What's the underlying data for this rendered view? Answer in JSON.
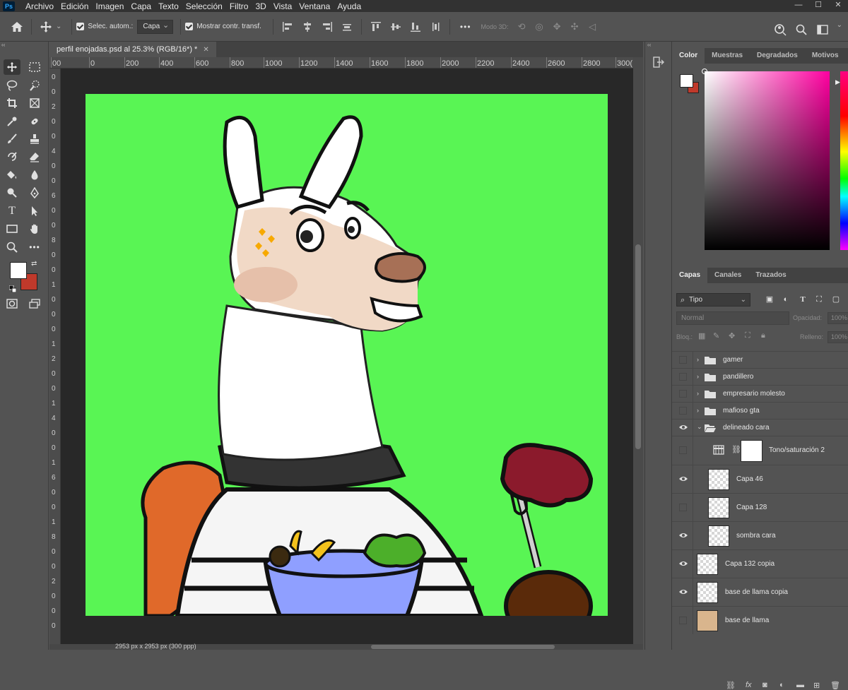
{
  "app": {
    "logo_text": "Ps",
    "menu": [
      "Archivo",
      "Edición",
      "Imagen",
      "Capa",
      "Texto",
      "Selección",
      "Filtro",
      "3D",
      "Vista",
      "Ventana",
      "Ayuda"
    ],
    "window_controls": [
      "—",
      "☐",
      "✕"
    ]
  },
  "options_bar": {
    "auto_select_label": "Selec. autom.:",
    "auto_select_target": "Capa",
    "show_transform_label": "Mostrar contr. transf.",
    "mode_3d_label": "Modo 3D:",
    "more_label": "•••"
  },
  "document": {
    "tab_title": "perfil enojadas.psd al 25.3% (RGB/16*) *",
    "close_glyph": "✕",
    "ruler_top_labels": [
      "00",
      "0",
      "200",
      "400",
      "600",
      "800",
      "1000",
      "1200",
      "1400",
      "1600",
      "1800",
      "2000",
      "2200",
      "2400",
      "2600",
      "2800",
      "300("
    ],
    "ruler_left_labels": [
      "0",
      "0",
      "2",
      "0",
      "0",
      "4",
      "0",
      "0",
      "6",
      "0",
      "0",
      "8",
      "0",
      "0",
      "1",
      "0",
      "0",
      "0",
      "1",
      "2",
      "0",
      "0",
      "1",
      "4",
      "0",
      "0",
      "1",
      "6",
      "0",
      "0",
      "1",
      "8",
      "0",
      "0",
      "2",
      "0",
      "0",
      "0"
    ],
    "canvas_color": "#59f554",
    "status_text": "2953 px x 2953 px (300 ppp)"
  },
  "colors": {
    "foreground": "#ffffff",
    "background": "#c0392b"
  },
  "color_panel": {
    "tabs": [
      "Color",
      "Muestras",
      "Degradados",
      "Motivos"
    ],
    "active_tab": "Color",
    "hue_color": "#ff00a0"
  },
  "layers_panel": {
    "tabs": [
      "Capas",
      "Canales",
      "Trazados"
    ],
    "active_tab": "Capas",
    "filter_kind": "Tipo",
    "blend_mode": "Normal",
    "opacity_label": "Opacidad:",
    "opacity_value": "100%",
    "lock_label": "Bloq.:",
    "fill_label": "Relleno:",
    "fill_value": "100%",
    "layers": [
      {
        "name": "gamer",
        "type": "group",
        "visible": false,
        "expanded": false
      },
      {
        "name": "pandillero",
        "type": "group",
        "visible": false,
        "expanded": false
      },
      {
        "name": "empresario molesto",
        "type": "group",
        "visible": false,
        "expanded": false
      },
      {
        "name": "mafioso gta",
        "type": "group",
        "visible": false,
        "expanded": false
      },
      {
        "name": "delineado cara",
        "type": "group",
        "visible": true,
        "expanded": true
      },
      {
        "name": "Tono/saturación 2",
        "type": "adjustment",
        "visible": false
      },
      {
        "name": "Capa 46",
        "type": "layer",
        "visible": true
      },
      {
        "name": "Capa 128",
        "type": "layer",
        "visible": false
      },
      {
        "name": "sombra cara",
        "type": "layer",
        "visible": true
      },
      {
        "name": "Capa 132 copia",
        "type": "layer",
        "visible": true
      },
      {
        "name": "base de llama copia",
        "type": "layer",
        "visible": true
      },
      {
        "name": "base de llama",
        "type": "layer",
        "visible": false
      }
    ]
  }
}
